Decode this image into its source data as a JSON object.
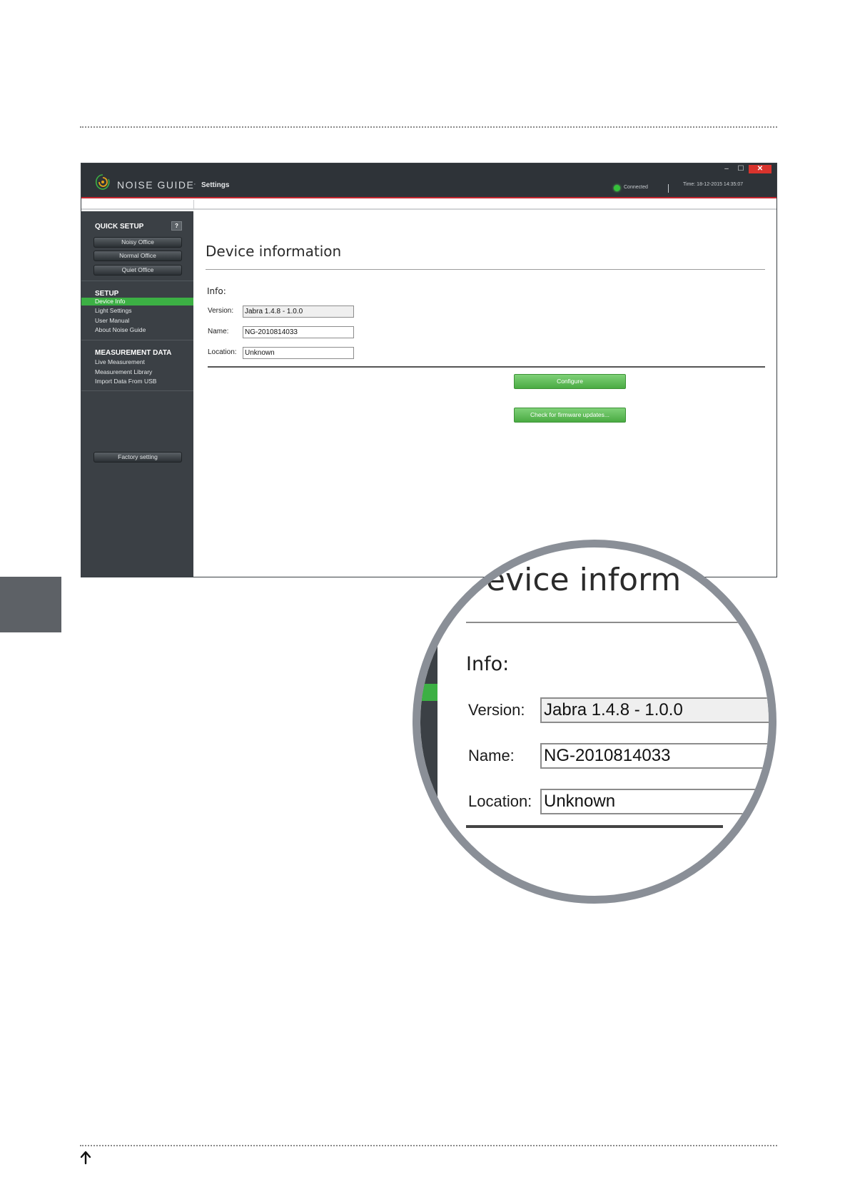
{
  "window": {
    "brand": "NOISE GUIDE",
    "separator": "·",
    "page": "Settings",
    "minimize": "–",
    "maximize": "☐",
    "close": "✕",
    "status": "Connected",
    "time": "Time: 18-12-2015 14:35:07"
  },
  "sidebar": {
    "quick_setup": {
      "heading": "QUICK SETUP",
      "help": "?",
      "buttons": [
        "Noisy Office",
        "Normal Office",
        "Quiet Office"
      ]
    },
    "setup": {
      "heading": "SETUP",
      "items": [
        "Device Info",
        "Light Settings",
        "User Manual",
        "About Noise Guide"
      ],
      "active_index": 0
    },
    "measurement_data": {
      "heading": "MEASUREMENT DATA",
      "items": [
        "Live Measurement",
        "Measurement Library",
        "Import Data From USB"
      ]
    },
    "factory_button": "Factory setting"
  },
  "content": {
    "title": "Device information",
    "info_label": "Info:",
    "fields": {
      "version": {
        "label": "Version:",
        "value": "Jabra 1.4.8 - 1.0.0"
      },
      "name": {
        "label": "Name:",
        "value": "NG-2010814033"
      },
      "location": {
        "label": "Location:",
        "value": "Unknown"
      }
    },
    "configure_button": "Configure",
    "firmware_button": "Check for firmware updates..."
  },
  "magnifier": {
    "title_fragment": "evice inform"
  },
  "colors": {
    "titlebar": "#2e3338",
    "sidebar": "#3b4045",
    "accent_green": "#3cb044",
    "accent_red": "#c4262e",
    "magnifier_ring": "#8a8f97"
  }
}
